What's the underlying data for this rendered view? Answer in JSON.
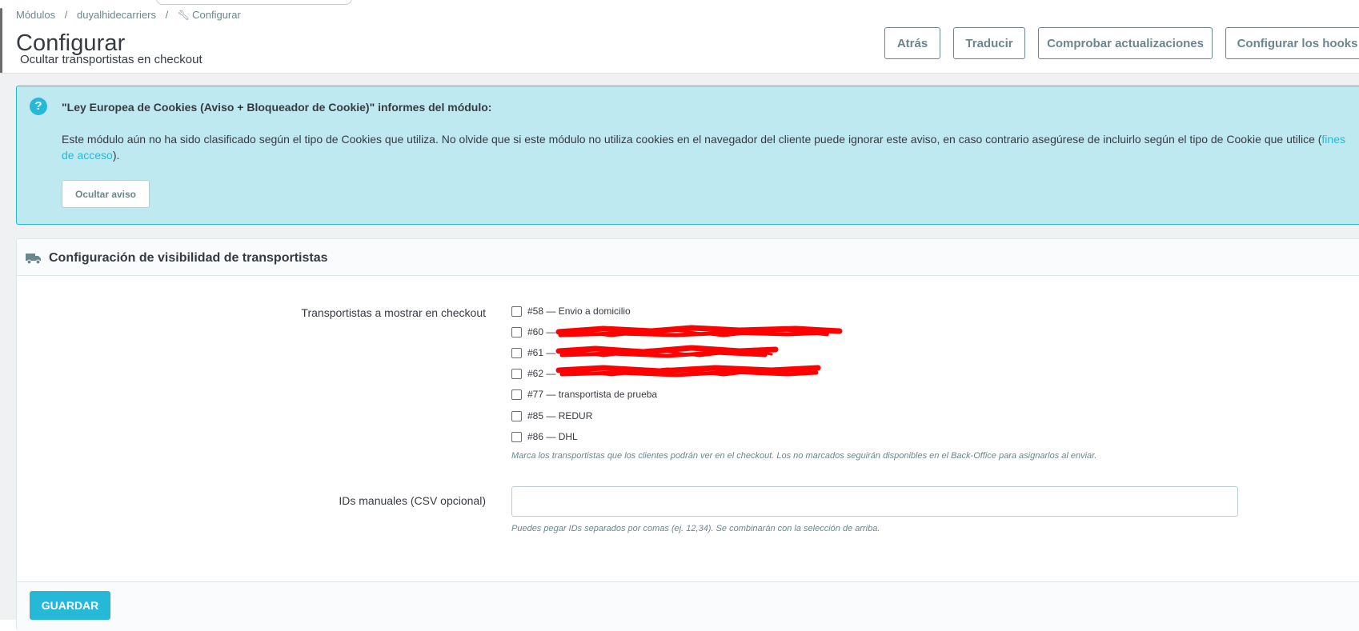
{
  "breadcrumb": {
    "items": [
      "Módulos",
      "duyalhidecarriers",
      "Configurar"
    ],
    "separator": "/"
  },
  "header": {
    "title": "Configurar",
    "subtitle": "Ocultar transportistas en checkout"
  },
  "toolbar": {
    "back_label": "Atrás",
    "translate_label": "Traducir",
    "check_updates_label": "Comprobar actualizaciones",
    "hooks_label": "Configurar los hooks"
  },
  "cookie_notice": {
    "title": "\"Ley Europea de Cookies (Aviso + Bloqueador de Cookie)\" informes del módulo:",
    "text_before_link": "Este módulo aún no ha sido clasificado según el tipo de Cookies que utiliza. No olvide que si este módulo no utiliza cookies en el navegador del cliente puede ignorar este aviso, en caso contrario asegúrese de incluirlo según el tipo de Cookie que utilice (",
    "link_text": "fines de acceso",
    "text_after_link": ").",
    "hide_button_label": "Ocultar aviso",
    "icon": "question-circle-icon"
  },
  "panel": {
    "title": "Configuración de visibilidad de transportistas",
    "icon": "truck-icon",
    "carriers_label": "Transportistas a mostrar en checkout",
    "carriers": [
      {
        "label": "#58 — Envio a domicilio",
        "checked": false,
        "redacted": false
      },
      {
        "label": "#60 —",
        "checked": false,
        "redacted": true
      },
      {
        "label": "#61 —",
        "checked": false,
        "redacted": true
      },
      {
        "label": "#62 —",
        "checked": false,
        "redacted": true
      },
      {
        "label": "#77 — transportista de prueba",
        "checked": false,
        "redacted": false
      },
      {
        "label": "#85 — REDUR",
        "checked": false,
        "redacted": false
      },
      {
        "label": "#86 — DHL",
        "checked": false,
        "redacted": false
      }
    ],
    "carriers_help": "Marca los transportistas que los clientes podrán ver en el checkout. Los no marcados seguirán disponibles en el Back-Office para asignarlos al enviar.",
    "manual_ids_label": "IDs manuales (CSV opcional)",
    "manual_ids_value": "",
    "manual_ids_help": "Puedes pegar IDs separados por comas (ej. 12,34). Se combinarán con la selección de arriba.",
    "save_label": "GUARDAR"
  },
  "colors": {
    "accent": "#25b9d7",
    "alert_bg": "#bfe9f0",
    "muted_text": "#6c868e",
    "redaction": "#ff0000"
  }
}
